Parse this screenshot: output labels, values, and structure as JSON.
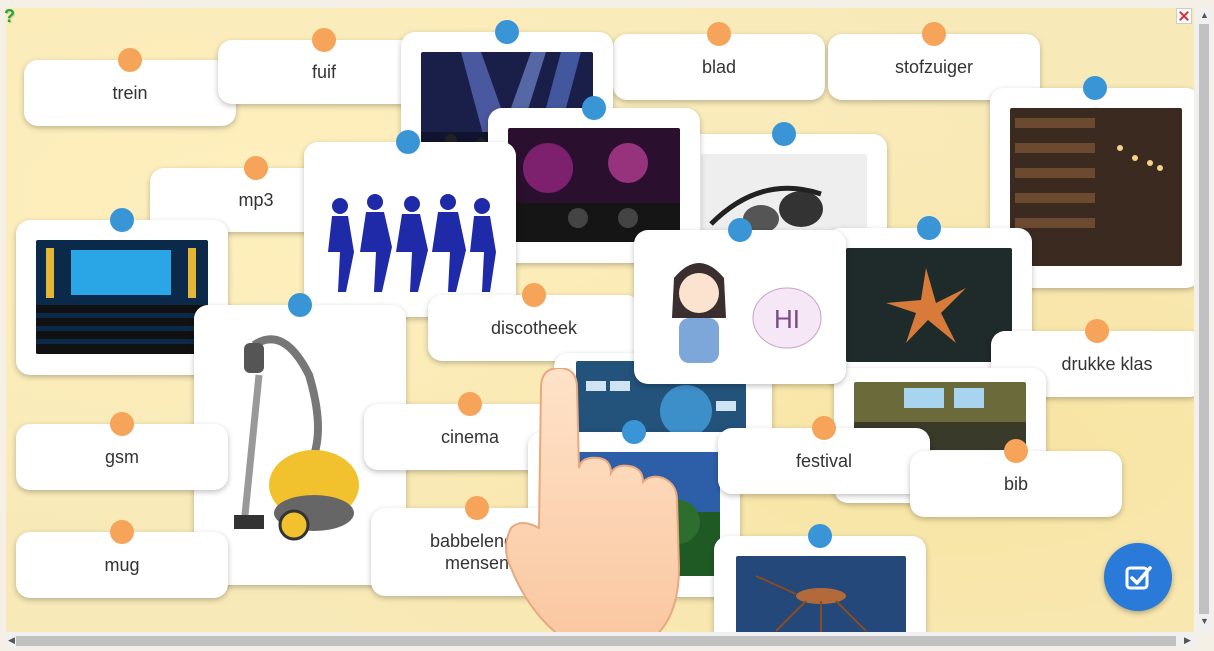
{
  "app": {
    "help_icon": "question-icon",
    "fullscreen_icon": "expand-icon",
    "submit_icon": "checkmark-edit-icon"
  },
  "words": {
    "trein": "trein",
    "fuif": "fuif",
    "blad": "blad",
    "stofzuiger": "stofzuiger",
    "mp3": "mp3",
    "discotheek": "discotheek",
    "drukke_klas": "drukke klas",
    "gsm": "gsm",
    "cinema": "cinema",
    "festival": "festival",
    "bib": "bib",
    "mug": "mug",
    "babbelende_mensen": "babbelende mensen"
  },
  "images": {
    "concert": "concert-photo",
    "dj": "dj-party-photo",
    "headphones": "headphones-photo",
    "library": "library-photo",
    "dancers": "dancers-silhouette",
    "cinema": "cinema-hall-photo",
    "girl_hi": "girl-saying-hi",
    "leaf": "leaf-photo",
    "vacuum": "vacuum-cleaner-photo",
    "social": "social-keyboard-photo",
    "classroom": "lecture-hall-photo",
    "forest": "forest-photo",
    "mosquito": "mosquito-photo",
    "hi_text": "HI"
  },
  "colors": {
    "orange_dot": "#f5a45a",
    "blue_dot": "#3a95d6",
    "submit_button": "#2a7ad9",
    "background": "#f8e9b8"
  }
}
